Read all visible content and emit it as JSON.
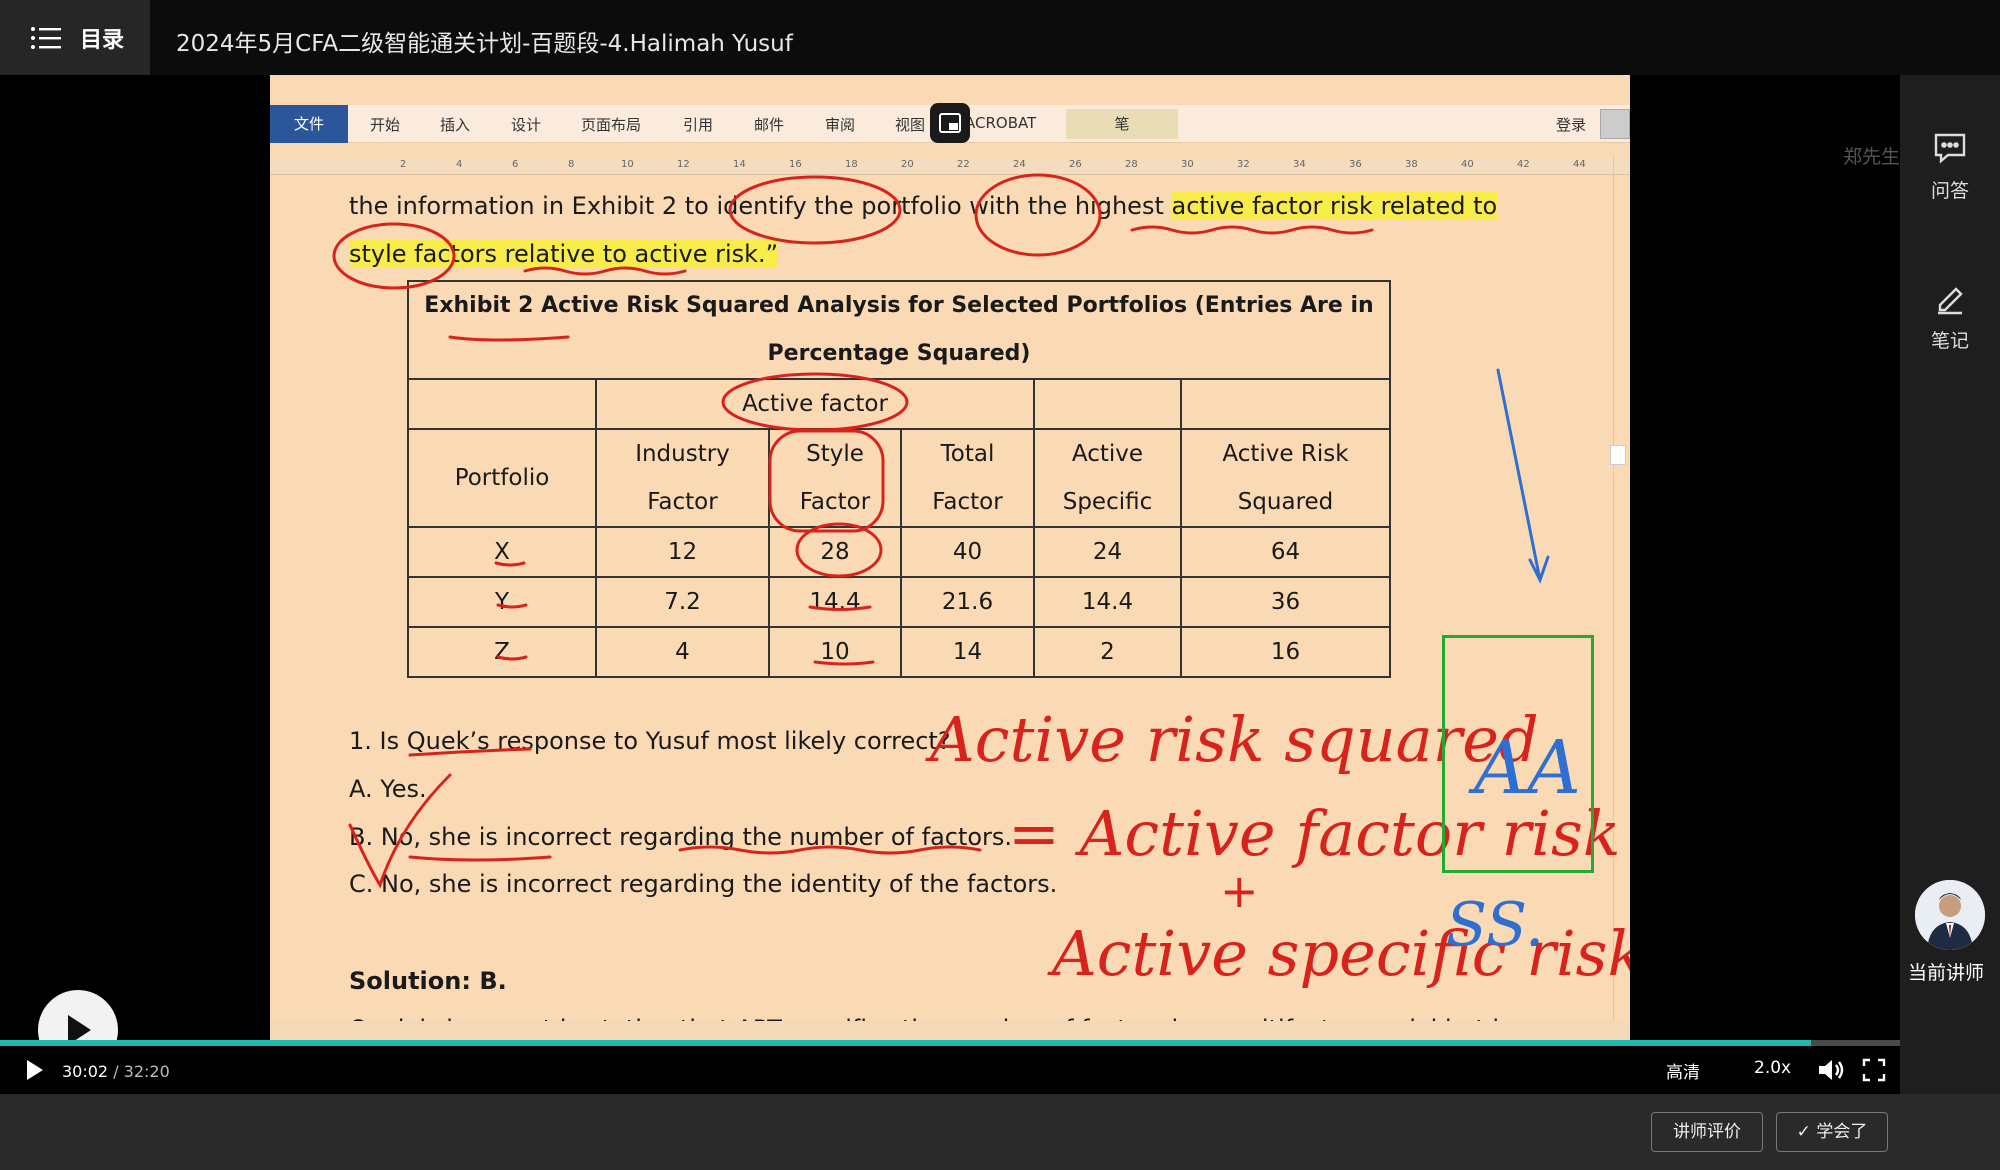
{
  "header": {
    "menu_label": "目录",
    "title": "2024年5月CFA二级智能通关计划-百题段-4.Halimah Yusuf"
  },
  "word": {
    "ribbon_tabs": [
      "文件",
      "开始",
      "插入",
      "设计",
      "页面布局",
      "引用",
      "邮件",
      "审阅",
      "视图",
      "ACROBAT",
      "笔"
    ],
    "login": "登录",
    "ruler_numbers": [
      "2",
      "4",
      "6",
      "8",
      "10",
      "12",
      "14",
      "16",
      "18",
      "20",
      "22",
      "24",
      "26",
      "28",
      "30",
      "32",
      "34",
      "36",
      "38",
      "40",
      "42",
      "44"
    ]
  },
  "document": {
    "line1_a": "the information in Exhibit 2 to identify the portfolio with the highest ",
    "line1_b": "active factor risk related to",
    "line2_a": "style factors",
    "line2_b": " relative to active risk.”",
    "exhibit_caption_1": "Exhibit 2  Active Risk Squared Analysis for Selected Portfolios (Entries Are in",
    "exhibit_caption_2": "Percentage Squared)",
    "group_header": "Active factor",
    "columns": [
      "Portfolio",
      "Industry\nFactor",
      "Style\nFactor",
      "Total\nFactor",
      "Active\nSpecific",
      "Active Risk\nSquared"
    ],
    "rows": [
      [
        "X",
        "12",
        "28",
        "40",
        "24",
        "64"
      ],
      [
        "Y",
        "7.2",
        "14.4",
        "21.6",
        "14.4",
        "36"
      ],
      [
        "Z",
        "4",
        "10",
        "14",
        "2",
        "16"
      ]
    ],
    "question": "1.    Is Quek’s response to Yusuf most likely correct?",
    "option_a": "A.     Yes.",
    "option_b": "B.     No, she is incorrect regarding the number of factors.",
    "option_c": "C.     No, she is incorrect regarding the identity of the factors.",
    "solution": "Solution: B.",
    "solution_text": "Quek is incorrect in stating that APT specifies the number of factors in a multifactor model but is"
  },
  "handwriting": {
    "line1": "Active risk squared",
    "line2": "= Active factor risk",
    "plus": "+",
    "line3": "Active specific risk",
    "ss": "SS.",
    "box_text": "AA"
  },
  "watermark": "郑先生",
  "player": {
    "current_time": "30:02",
    "duration": "32:20",
    "progress": 0.953,
    "quality": "高清",
    "speed": "2.0x"
  },
  "sidebar": {
    "qa_label": "问答",
    "notes_label": "笔记",
    "lecturer_label": "当前讲师"
  },
  "footer": {
    "rate_teacher": "讲师评价",
    "learned": "✓ 学会了"
  },
  "colors": {
    "doc_bg": "#fad9b5",
    "highlight": "#f7ec4a",
    "ink_red": "#d8231d",
    "ink_blue": "#2f6fd1",
    "accent_teal": "#1fb8b0",
    "box_green": "#22aa33"
  }
}
